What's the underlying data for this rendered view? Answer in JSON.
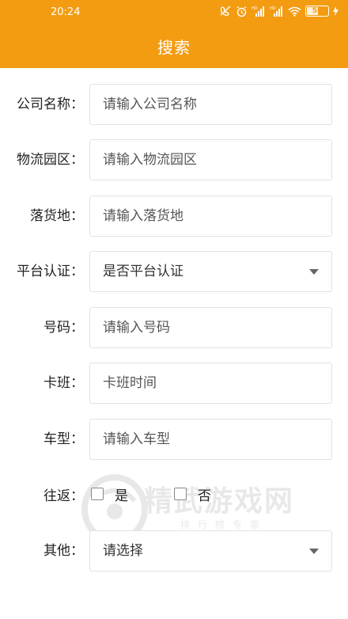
{
  "status_bar": {
    "time": "20:24",
    "battery": "56",
    "battery_level": 0.56,
    "icons": [
      "no-call-icon",
      "alarm-icon",
      "hd-signal-icon",
      "hd-signal-icon",
      "wifi-icon",
      "battery-icon",
      "charging-icon"
    ]
  },
  "header": {
    "title": "搜索",
    "background_color": "#F39C12"
  },
  "form": {
    "company": {
      "label": "公司名称：",
      "placeholder": "请输入公司名称"
    },
    "park": {
      "label": "物流园区：",
      "placeholder": "请输入物流园区"
    },
    "destination": {
      "label": "落货地：",
      "placeholder": "请输入落货地"
    },
    "certified": {
      "label": "平台认证：",
      "value": "是否平台认证"
    },
    "number": {
      "label": "号码：",
      "placeholder": "请输入号码"
    },
    "schedule": {
      "label": "卡班：",
      "placeholder": "卡班时间"
    },
    "vehicle": {
      "label": "车型：",
      "placeholder": "请输入车型"
    },
    "round_trip": {
      "label": "往返：",
      "yes": "是",
      "no": "否"
    },
    "other": {
      "label": "其他：",
      "value": "请选择"
    }
  },
  "watermark": {
    "text": "精武游戏网",
    "subtext": "排行榜专家"
  }
}
